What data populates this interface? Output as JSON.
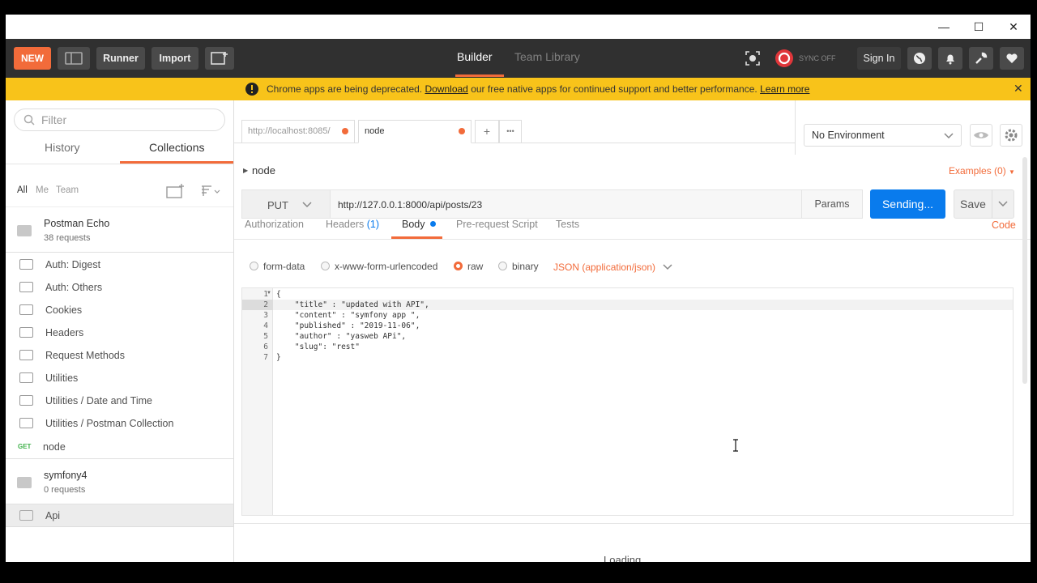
{
  "window": {
    "minimize": "—",
    "maximize": "☐",
    "close": "✕"
  },
  "header": {
    "new_label": "NEW",
    "runner_label": "Runner",
    "import_label": "Import",
    "tab_builder": "Builder",
    "tab_team_library": "Team Library",
    "sync_label": "SYNC OFF",
    "sign_in_label": "Sign In"
  },
  "banner": {
    "text_before": "Chrome apps are being deprecated.",
    "download_link": "Download",
    "text_after": "our free native apps for continued support and better performance.",
    "learn_more_link": "Learn more"
  },
  "sidebar": {
    "filter_placeholder": "Filter",
    "tab_history": "History",
    "tab_collections": "Collections",
    "owner_all": "All",
    "owner_me": "Me",
    "owner_team": "Team",
    "collection1": {
      "name": "Postman Echo",
      "count": "38 requests"
    },
    "subfolders": [
      "Auth: Digest",
      "Auth: Others",
      "Cookies",
      "Headers",
      "Request Methods",
      "Utilities",
      "Utilities / Date and Time",
      "Utilities / Postman Collection"
    ],
    "request": {
      "method": "GET",
      "name": "node"
    },
    "collection2": {
      "name": "symfony4",
      "count": "0 requests"
    },
    "collection3": {
      "name": "Api"
    }
  },
  "tabs": {
    "tab1_label": "http://localhost:8085/",
    "tab2_label": "node",
    "add_label": "+",
    "more_label": "•••"
  },
  "environment": {
    "selected": "No Environment"
  },
  "request": {
    "name": "node",
    "examples_label": "Examples (0)",
    "method": "PUT",
    "url": "http://127.0.0.1:8000/api/posts/23",
    "params_label": "Params",
    "send_label": "Sending...",
    "save_label": "Save",
    "code_label": "Code"
  },
  "subtabs": {
    "authorization": "Authorization",
    "headers": "Headers",
    "headers_count": "(1)",
    "body": "Body",
    "prerequest": "Pre-request Script",
    "tests": "Tests"
  },
  "body_modes": {
    "form_data": "form-data",
    "urlencoded": "x-www-form-urlencoded",
    "raw": "raw",
    "binary": "binary",
    "content_type": "JSON (application/json)"
  },
  "editor": {
    "line_numbers": [
      "1",
      "2",
      "3",
      "4",
      "5",
      "6",
      "7"
    ],
    "lines": [
      "{",
      "    \"title\" : \"updated with API\",",
      "    \"content\" : \"symfony app \",",
      "    \"published\" : \"2019-11-06\",",
      "    \"author\" : \"yasweb APi\",",
      "    \"slug\": \"rest\"",
      "}"
    ]
  },
  "response": {
    "status": "Loading..."
  },
  "colors": {
    "accent": "#f26b3a",
    "send_blue": "#097bed",
    "banner": "#f8c31a",
    "header_bg": "#303030"
  }
}
